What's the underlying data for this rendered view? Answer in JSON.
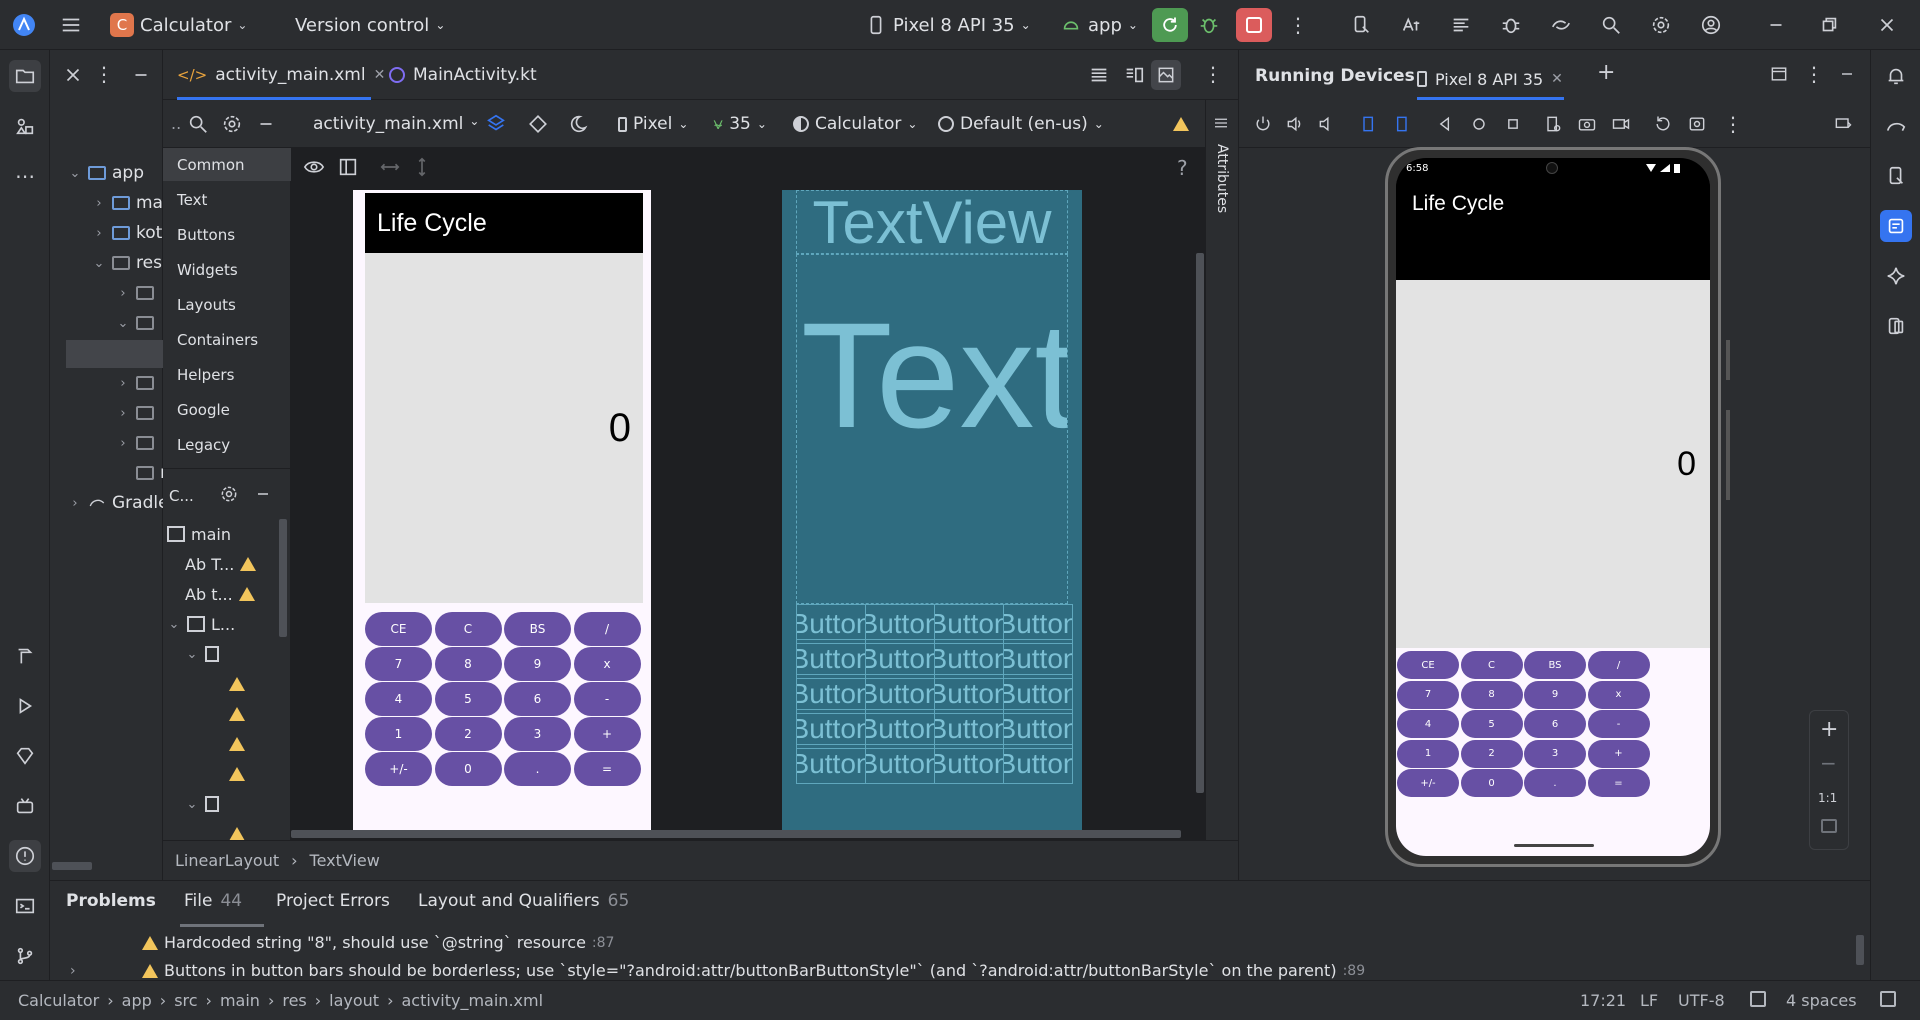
{
  "titlebar": {
    "project_badge": "C",
    "project_name": "Calculator",
    "version_control": "Version control",
    "device": "Pixel 8 API 35",
    "run_config": "app"
  },
  "project_tree": {
    "items": [
      {
        "label": "app"
      },
      {
        "label": "ma"
      },
      {
        "label": "kot"
      },
      {
        "label": "res"
      },
      {
        "label": "res"
      },
      {
        "label": "Gradle"
      }
    ]
  },
  "editor": {
    "tabs": [
      {
        "label": "activity_main.xml"
      },
      {
        "label": "MainActivity.kt"
      }
    ],
    "toolbar": {
      "file": "activity_main.xml",
      "device": "Pixel",
      "api": "35",
      "theme": "Calculator",
      "locale": "Default (en-us)"
    }
  },
  "palette": {
    "categories": [
      "Common",
      "Text",
      "Buttons",
      "Widgets",
      "Layouts",
      "Containers",
      "Helpers",
      "Google",
      "Legacy"
    ]
  },
  "component_tree": {
    "title": "C...",
    "items": [
      "main",
      "Ab T...",
      "Ab t...",
      "L..."
    ]
  },
  "preview": {
    "app_title": "Life Cycle",
    "display_value": "0",
    "buttons": [
      [
        "CE",
        "C",
        "BS",
        "/"
      ],
      [
        "7",
        "8",
        "9",
        "x"
      ],
      [
        "4",
        "5",
        "6",
        "-"
      ],
      [
        "1",
        "2",
        "3",
        "+"
      ],
      [
        "+/-",
        "0",
        ".",
        "="
      ]
    ],
    "blueprint_text_small": "TextView",
    "blueprint_text_big": "TextV",
    "blueprint_button": "Button"
  },
  "breadcrumb": {
    "items": [
      "LinearLayout",
      "TextView"
    ]
  },
  "attributes_label": "Attributes",
  "running_devices": {
    "title": "Running Devices",
    "tab": "Pixel 8 API 35",
    "status_time": "6:58",
    "zoom_label": "1:1"
  },
  "problems": {
    "tabs": [
      {
        "label": "Problems"
      },
      {
        "label": "File",
        "count": "44"
      },
      {
        "label": "Project Errors"
      },
      {
        "label": "Layout and Qualifiers",
        "count": "65"
      }
    ],
    "rows": [
      {
        "text": "Hardcoded string \"8\", should use `@string` resource",
        "line": ":87"
      },
      {
        "text": "Buttons in button bars should be borderless; use `style=\"?android:attr/buttonBarButtonStyle\"` (and `?android:attr/buttonBarStyle` on the parent)",
        "line": ":89"
      }
    ]
  },
  "statusbar": {
    "path": [
      "Calculator",
      "app",
      "src",
      "main",
      "res",
      "layout",
      "activity_main.xml"
    ],
    "position": "17:21",
    "line_sep": "LF",
    "encoding": "UTF-8",
    "indent": "4 spaces"
  },
  "colors": {
    "accent": "#3574f0",
    "button_purple": "#6750a4",
    "blueprint": "#2f6c80",
    "run_green": "#4e9a53",
    "stop_red": "#db5c5c",
    "warning": "#f2c55c"
  }
}
